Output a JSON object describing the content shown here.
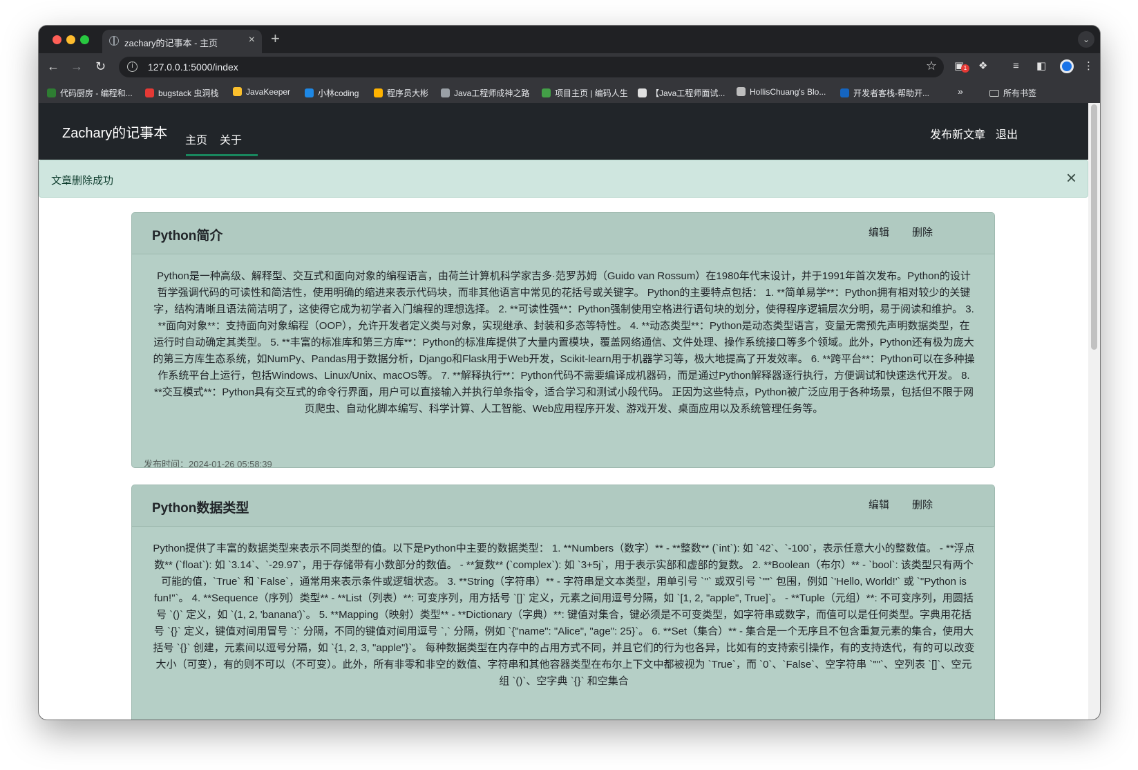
{
  "browser": {
    "tab_title": "zachary的记事本 - 主页",
    "tab_close": "×",
    "new_tab": "+",
    "url": "127.0.0.1:5000/index",
    "badge_count": "1",
    "bookmarks": [
      {
        "label": "代码厨房 - 编程和...",
        "color": "#2e7d32"
      },
      {
        "label": "bugstack 虫洞栈",
        "color": "#e53935"
      },
      {
        "label": "JavaKeeper",
        "color": "#fbc02d"
      },
      {
        "label": "小林coding",
        "color": "#1e88e5"
      },
      {
        "label": "程序员大彬",
        "color": "#ffb300"
      },
      {
        "label": "Java工程师成神之路",
        "color": "#9aa0a6"
      },
      {
        "label": "项目主页 | 编码人生",
        "color": "#43a047"
      },
      {
        "label": "【Java工程师面试...",
        "color": "#e0e0e0"
      },
      {
        "label": "HollisChuang's Blo...",
        "color": "#bdbdbd"
      },
      {
        "label": "开发者客栈-帮助开...",
        "color": "#1565c0"
      }
    ],
    "bookmarks_overflow": "»",
    "all_bookmarks": "所有书签"
  },
  "app": {
    "brand": "Zachary的记事本",
    "nav": {
      "home": "主页",
      "about": "关于"
    },
    "actions": {
      "publish": "发布新文章",
      "logout": "退出"
    },
    "alert": {
      "message": "文章删除成功",
      "close": "×"
    }
  },
  "articles": [
    {
      "title": "Python简介",
      "edit": "编辑",
      "delete": "删除",
      "body": "Python是一种高级、解释型、交互式和面向对象的编程语言，由荷兰计算机科学家吉多·范罗苏姆（Guido van Rossum）在1980年代末设计，并于1991年首次发布。Python的设计哲学强调代码的可读性和简洁性，使用明确的缩进来表示代码块，而非其他语言中常见的花括号或关键字。 Python的主要特点包括： 1. **简单易学**：Python拥有相对较少的关键字，结构清晰且语法简洁明了，这使得它成为初学者入门编程的理想选择。 2. **可读性强**：Python强制使用空格进行语句块的划分，使得程序逻辑层次分明，易于阅读和维护。 3. **面向对象**：支持面向对象编程（OOP），允许开发者定义类与对象，实现继承、封装和多态等特性。 4. **动态类型**：Python是动态类型语言，变量无需预先声明数据类型，在运行时自动确定其类型。 5. **丰富的标准库和第三方库**：Python的标准库提供了大量内置模块，覆盖网络通信、文件处理、操作系统接口等多个领域。此外，Python还有极为庞大的第三方库生态系统，如NumPy、Pandas用于数据分析，Django和Flask用于Web开发，Scikit-learn用于机器学习等，极大地提高了开发效率。 6. **跨平台**：Python可以在多种操作系统平台上运行，包括Windows、Linux/Unix、macOS等。 7. **解释执行**：Python代码不需要编译成机器码，而是通过Python解释器逐行执行，方便调试和快速迭代开发。 8. **交互模式**：Python具有交互式的命令行界面，用户可以直接输入并执行单条指令，适合学习和测试小段代码。 正因为这些特点，Python被广泛应用于各种场景，包括但不限于网页爬虫、自动化脚本编写、科学计算、人工智能、Web应用程序开发、游戏开发、桌面应用以及系统管理任务等。",
      "time": "发布时间：2024-01-26 05:58:39"
    },
    {
      "title": "Python数据类型",
      "edit": "编辑",
      "delete": "删除",
      "body": "Python提供了丰富的数据类型来表示不同类型的值。以下是Python中主要的数据类型： 1. **Numbers（数字）** - **整数** (`int`): 如 `42`、`-100`，表示任意大小的整数值。 - **浮点数** (`float`): 如 `3.14`、`-29.97`，用于存储带有小数部分的数值。 - **复数** (`complex`): 如 `3+5j`，用于表示实部和虚部的复数。 2. **Boolean（布尔）** - `bool`: 该类型只有两个可能的值，`True` 和 `False`，通常用来表示条件或逻辑状态。 3. **String（字符串）** - 字符串是文本类型，用单引号 `''` 或双引号 `\"\"` 包围，例如 `'Hello, World!'` 或 `\"Python is fun!\"`。 4. **Sequence（序列）类型** - **List（列表）**: 可变序列，用方括号 `[]` 定义，元素之间用逗号分隔，如 `[1, 2, \"apple\", True]`。 - **Tuple（元组）**: 不可变序列，用圆括号 `()` 定义，如 `(1, 2, 'banana')`。 5. **Mapping（映射）类型** - **Dictionary（字典）**: 键值对集合，键必须是不可变类型，如字符串或数字，而值可以是任何类型。字典用花括号 `{}` 定义，键值对间用冒号 `:` 分隔，不同的键值对间用逗号 `,` 分隔，例如 `{\"name\": \"Alice\", \"age\": 25}`。 6. **Set（集合）** - 集合是一个无序且不包含重复元素的集合，使用大括号 `{}` 创建，元素间以逗号分隔，如 `{1, 2, 3, \"apple\"}`。 每种数据类型在内存中的占用方式不同，并且它们的行为也各异，比如有的支持索引操作，有的支持迭代，有的可以改变大小（可变），有的则不可以（不可变）。此外，所有非零和非空的数值、字符串和其他容器类型在布尔上下文中都被视为 `True`，而 `0`、`False`、空字符串 `\"\"`、空列表 `[]`、空元组 `()`、空字典 `{}` 和空集合",
      "time": ""
    }
  ]
}
